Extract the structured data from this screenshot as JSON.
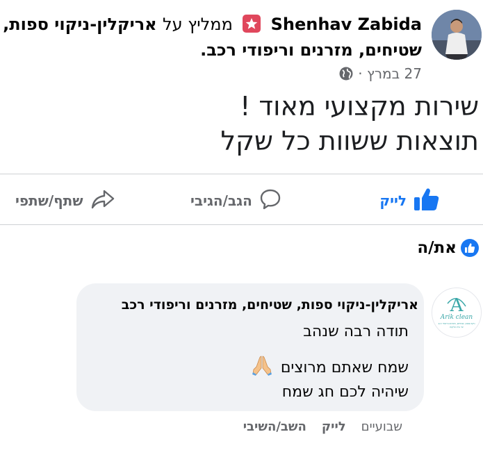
{
  "post": {
    "author": "Shenhav Zabida",
    "recommends": "ממליץ על",
    "page_name_part1": "אריקלין-ניקוי ספות,",
    "page_name_part2": "שטיחים, מזרנים וריפודי רכב.",
    "date": "27 במרץ",
    "separator": "·",
    "privacy_icon": "globe-icon",
    "text_line1": "שירות מקצועי מאוד !",
    "text_line2": "תוצאות ששוות כל שקל"
  },
  "actions": {
    "like": "לייק",
    "comment": "הגב/הגיבי",
    "share": "שתף/שתפי"
  },
  "reactors": {
    "label": "את/ה"
  },
  "comment": {
    "author": "אריקלין-ניקוי ספות, שטיחים, מזרנים וריפודי רכב",
    "line1": "תודה רבה שנהב",
    "line2": "שמח שאתם מרוצים",
    "line3": "שיהיה לכם חג שמח",
    "time": "שבועיים",
    "like": "לייק",
    "reply": "השב/השיבי"
  },
  "page_logo": {
    "letter": "A",
    "line1": "Arik clean",
    "line2": "ניקוי ספות, שטיחים, מזרנים וריפודי רכב",
    "line3": "עד בית הלקוח"
  },
  "colors": {
    "accent": "#1877f2",
    "recommend_badge": "#e0475c",
    "secondary_text": "#65676b",
    "bubble": "#f0f2f5",
    "logo_teal": "#3aa7a8"
  }
}
